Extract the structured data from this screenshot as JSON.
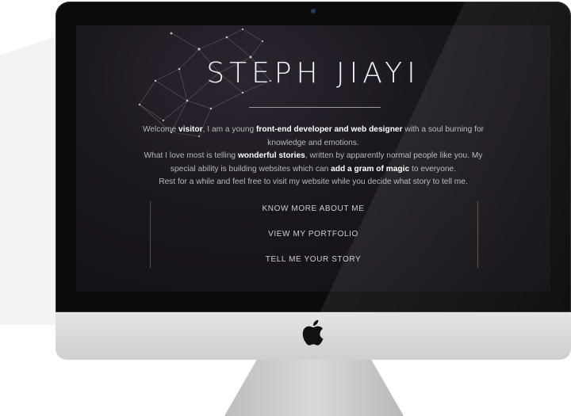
{
  "site": {
    "title": "STEPH JIAYI",
    "intro": {
      "line1_a": "Welcome ",
      "line1_visitor": "visitor",
      "line1_b": ", I am a young ",
      "line1_role": "front-end developer and web designer",
      "line1_c": " with a soul burning for knowledge and emotions.",
      "line2_a": "What I love most is telling ",
      "line2_stories": "wonderful stories",
      "line2_b": ", written by apparently normal people like you. My special ability is building websites which can ",
      "line2_magic": "add a gram of magic",
      "line2_c": " to everyone.",
      "line3": "Rest for a while and feel free to visit my website while you decide what story to tell me."
    },
    "nav": [
      {
        "label": "KNOW MORE ABOUT ME"
      },
      {
        "label": "VIEW MY PORTFOLIO"
      },
      {
        "label": "TELL ME YOUR STORY"
      }
    ]
  },
  "icons": {
    "logo": "apple-logo-icon",
    "camera": "webcam-icon"
  },
  "colors": {
    "screen_bg": "#1a161d",
    "bezel": "#0c0c0d",
    "chin": "#d8d8d8",
    "accent_line": "#5a4a45"
  }
}
